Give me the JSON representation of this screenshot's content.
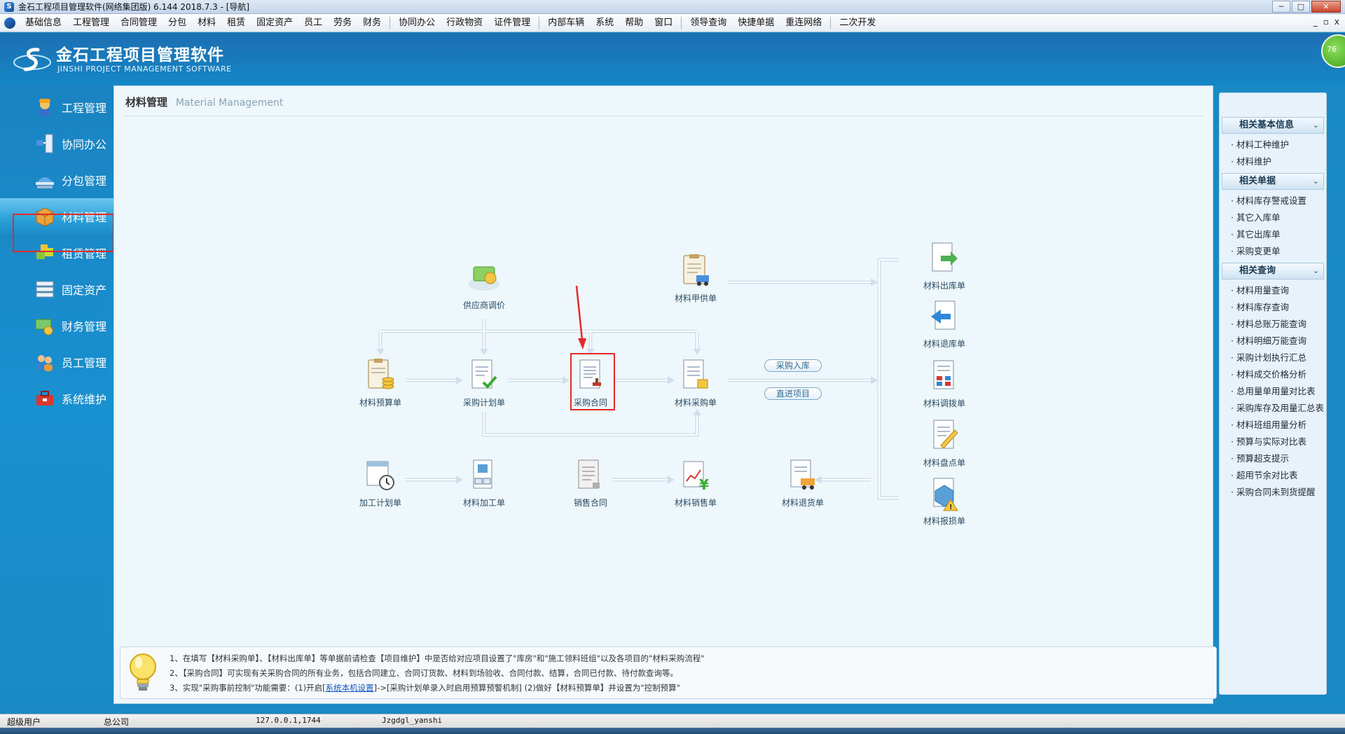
{
  "window": {
    "title": "金石工程项目管理软件(网络集团版) 6.144  2018.7.3 - [导航]",
    "controls": [
      "─",
      "□",
      "✕"
    ]
  },
  "menubar": {
    "groups": [
      [
        "基础信息",
        "工程管理",
        "合同管理",
        "分包",
        "材料",
        "租赁",
        "固定资产",
        "员工",
        "劳务",
        "财务"
      ],
      [
        "协同办公",
        "行政物资",
        "证件管理"
      ],
      [
        "内部车辆",
        "系统",
        "帮助",
        "窗口"
      ],
      [
        "领导查询",
        "快捷单据",
        "重连网络"
      ],
      [
        "二次开发"
      ]
    ],
    "right_controls": [
      "_",
      "▫",
      "x"
    ]
  },
  "header": {
    "name_cn": "金石工程项目管理软件",
    "name_en": "JINSHI PROJECT MANAGEMENT SOFTWARE",
    "badge": "76"
  },
  "nav": {
    "items": [
      {
        "label": "工程管理",
        "icon": "worker-icon"
      },
      {
        "label": "协同办公",
        "icon": "network-icon"
      },
      {
        "label": "分包管理",
        "icon": "hardhat-icon"
      },
      {
        "label": "材料管理",
        "icon": "box-icon"
      },
      {
        "label": "租赁管理",
        "icon": "blocks-icon"
      },
      {
        "label": "固定资产",
        "icon": "server-icon"
      },
      {
        "label": "财务管理",
        "icon": "money-icon"
      },
      {
        "label": "员工管理",
        "icon": "people-icon"
      },
      {
        "label": "系统维护",
        "icon": "toolbox-icon"
      }
    ],
    "active_index": 3
  },
  "main": {
    "title_cn": "材料管理",
    "title_en": "Material Management",
    "nodes": {
      "supplier_quote": "供应商调价",
      "owner_supply": "材料甲供单",
      "budget": "材料预算单",
      "purchase_plan": "采购计划单",
      "purchase_contract": "采购合同",
      "purchase_order": "材料采购单",
      "process_plan": "加工计划单",
      "process_order": "材料加工单",
      "sales_contract": "销售合同",
      "sales_order": "材料销售单",
      "return_goods": "材料退货单",
      "stock_out": "材料出库单",
      "stock_return": "材料退库单",
      "transfer": "材料调拨单",
      "inventory": "材料盘点单",
      "damage": "材料报损单"
    },
    "pills": {
      "inbound": "采购入库",
      "direct": "直进项目"
    },
    "tips": {
      "line1": "1、在填写【材料采购单】、【材料出库单】等单据前请检查【项目维护】中是否给对应项目设置了\"库房\"和\"施工领料班组\"以及各项目的\"材料采购流程\"",
      "line2": "2、【采购合同】可实现有关采购合同的所有业务，包括合同建立、合同订货款、材料到场验收、合同付款、结算，合同已付款、待付款查询等。",
      "line3_pre": "3、实现\"采购事前控制\"功能需要：(1)开启[",
      "line3_link": "系统本机设置",
      "line3_post": "]->[采购计划单录入时启用预算预警机制]  (2)做好【材料预算单】并设置为\"控制预算\""
    }
  },
  "right_panel": {
    "sections": [
      {
        "title": "相关基本信息",
        "items": [
          "材料工种维护",
          "材料维护"
        ]
      },
      {
        "title": "相关单据",
        "items": [
          "材料库存警戒设置",
          "其它入库单",
          "其它出库单",
          "采购变更单"
        ]
      },
      {
        "title": "相关查询",
        "items": [
          "材料用量查询",
          "材料库存查询",
          "材料总账万能查询",
          "材料明细万能查询",
          "采购计划执行汇总",
          "材料成交价格分析",
          "总用量单用量对比表",
          "采购库存及用量汇总表",
          "材料班组用量分析",
          "预算与实际对比表",
          "预算超支提示",
          "超用节余对比表",
          "采购合同未到货提醒"
        ]
      }
    ]
  },
  "statusbar": {
    "user": "超级用户",
    "company": "总公司",
    "server": "127.0.0.1,1744",
    "db": "Jzgdgl_yanshi"
  }
}
